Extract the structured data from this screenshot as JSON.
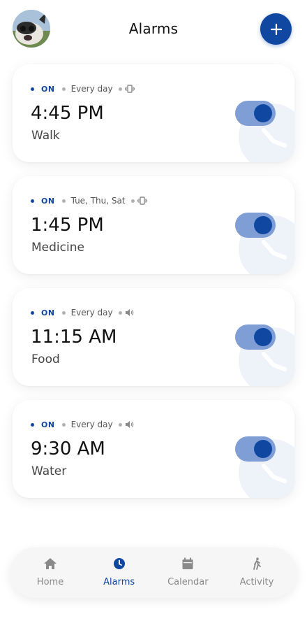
{
  "header": {
    "title": "Alarms",
    "add_icon": "plus-icon",
    "avatar": "user-avatar"
  },
  "colors": {
    "accent": "#0f47a1",
    "toggle_track": "#7f9ed6",
    "muted": "#8a8a8a"
  },
  "alarms": [
    {
      "status": "ON",
      "repeat": "Every day",
      "alert": "vibrate-icon",
      "time": "4:45 PM",
      "label": "Walk",
      "enabled": true
    },
    {
      "status": "ON",
      "repeat": "Tue, Thu, Sat",
      "alert": "vibrate-icon",
      "time": "1:45 PM",
      "label": "Medicine",
      "enabled": true
    },
    {
      "status": "ON",
      "repeat": "Every day",
      "alert": "sound-icon",
      "time": "11:15 AM",
      "label": "Food",
      "enabled": true
    },
    {
      "status": "ON",
      "repeat": "Every day",
      "alert": "sound-icon",
      "time": "9:30 AM",
      "label": "Water",
      "enabled": true
    }
  ],
  "nav": {
    "active": "Alarms",
    "items": [
      {
        "label": "Home",
        "icon": "home-icon"
      },
      {
        "label": "Alarms",
        "icon": "clock-icon"
      },
      {
        "label": "Calendar",
        "icon": "calendar-icon"
      },
      {
        "label": "Activity",
        "icon": "walk-icon"
      }
    ]
  }
}
